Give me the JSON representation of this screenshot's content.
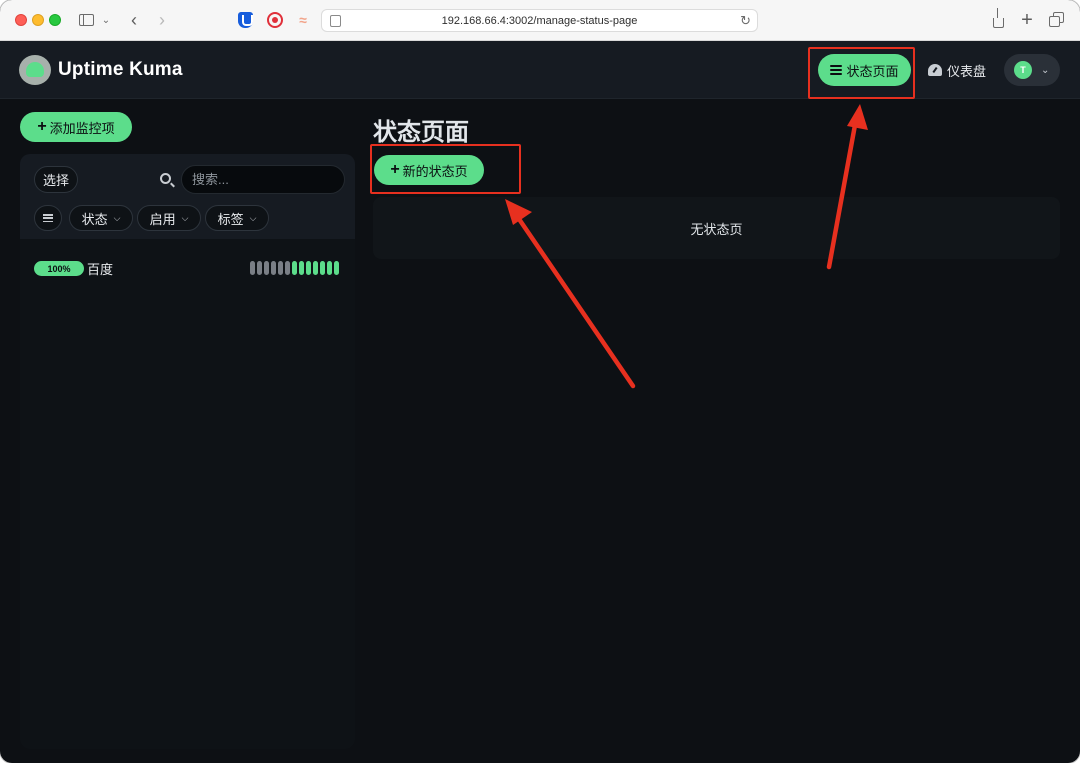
{
  "browser": {
    "url": "192.168.66.4:3002/manage-status-page"
  },
  "header": {
    "brand": "Uptime Kuma",
    "nav_status_pages": "状态页面",
    "nav_dashboard": "仪表盘",
    "avatar_initial": "T"
  },
  "sidebar": {
    "add_monitor_label": "添加监控项",
    "select_label": "选择",
    "search_placeholder": "搜索...",
    "filters": {
      "status": "状态",
      "active": "启用",
      "tags": "标签"
    },
    "monitors": [
      {
        "uptime": "100%",
        "name": "百度",
        "heartbeats": [
          "empty",
          "empty",
          "empty",
          "empty",
          "empty",
          "empty",
          "up",
          "up",
          "up",
          "up",
          "up",
          "up",
          "up"
        ]
      }
    ]
  },
  "main": {
    "title": "状态页面",
    "new_status_page_label": "新的状态页",
    "empty_text": "无状态页"
  },
  "colors": {
    "accent": "#5cdd8b",
    "annotation": "#e7301f",
    "heartbeat_empty": "#7a7f86"
  }
}
